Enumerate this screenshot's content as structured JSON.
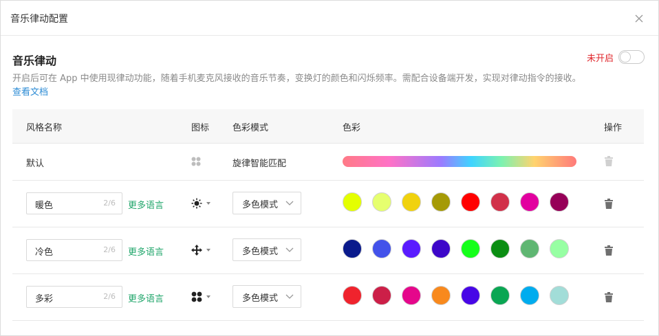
{
  "dialog": {
    "title": "音乐律动配置"
  },
  "section": {
    "title": "音乐律动",
    "toggle_status": "未开启",
    "description": "开启后可在 App 中使用现律动功能，随着手机麦克风接收的音乐节奏，变换灯的颜色和闪烁频率。需配合设备端开发，实现对律动指令的接收。",
    "doc_link": "查看文档"
  },
  "table": {
    "headers": {
      "name": "风格名称",
      "icon": "图标",
      "mode": "色彩模式",
      "colors": "色彩",
      "ops": "操作"
    },
    "rows": [
      {
        "name": "默认",
        "icon": "four-dots-icon",
        "mode": "旋律智能匹配"
      },
      {
        "name": "暖色",
        "count": "2/6",
        "more_lang": "更多语言",
        "icon": "sun-icon",
        "mode": "多色模式",
        "colors": [
          "#e4ff00",
          "#e6ff6f",
          "#f0d20e",
          "#a59a06",
          "#ff0000",
          "#d1314a",
          "#e2009f",
          "#960058"
        ]
      },
      {
        "name": "冷色",
        "count": "2/6",
        "more_lang": "更多语言",
        "icon": "move-arrows-icon",
        "mode": "多色模式",
        "colors": [
          "#0a1a8c",
          "#4352ea",
          "#5a1bff",
          "#3d07c9",
          "#15ff1a",
          "#0b8e13",
          "#5fb672",
          "#97ffa3"
        ]
      },
      {
        "name": "多彩",
        "count": "2/6",
        "more_lang": "更多语言",
        "icon": "four-circles-icon",
        "mode": "多色模式",
        "colors": [
          "#ef232d",
          "#cc1f48",
          "#e5078b",
          "#f8891d",
          "#4706e6",
          "#0aa653",
          "#00acee",
          "#a2ddd8"
        ]
      }
    ]
  }
}
